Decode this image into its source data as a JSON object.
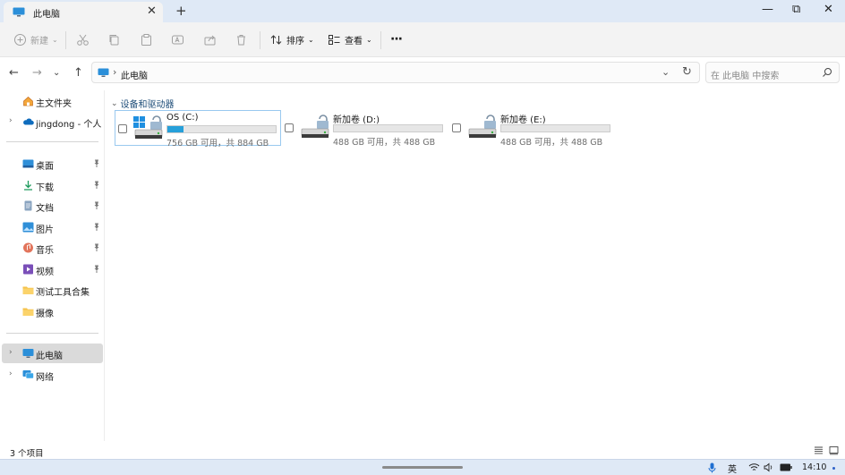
{
  "window": {
    "tab_title": "此电脑",
    "tab_close": "✕",
    "new_tab": "+",
    "minimize": "—",
    "maximize": "⧉",
    "close": "✕"
  },
  "toolbar": {
    "new_label": "新建",
    "sort_label": "排序",
    "view_label": "查看",
    "more_label": "···"
  },
  "address": {
    "location": "此电脑",
    "search_placeholder": "在 此电脑 中搜索"
  },
  "sidebar": {
    "top_items": [
      {
        "label": "主文件夹",
        "icon": "home-icon"
      },
      {
        "label": "jingdong - 个人",
        "icon": "cloud-icon"
      }
    ],
    "quick_access": [
      {
        "label": "桌面",
        "icon": "desktop-icon",
        "pinned": true
      },
      {
        "label": "下载",
        "icon": "download-icon",
        "pinned": true
      },
      {
        "label": "文档",
        "icon": "document-icon",
        "pinned": true
      },
      {
        "label": "图片",
        "icon": "pictures-icon",
        "pinned": true
      },
      {
        "label": "音乐",
        "icon": "music-icon",
        "pinned": true
      },
      {
        "label": "视频",
        "icon": "video-icon",
        "pinned": true
      },
      {
        "label": "测试工具合集",
        "icon": "folder-icon",
        "pinned": false
      },
      {
        "label": "摄像",
        "icon": "folder-icon",
        "pinned": false
      }
    ],
    "bottom_items": [
      {
        "label": "此电脑",
        "icon": "computer-icon",
        "selected": true
      },
      {
        "label": "网络",
        "icon": "network-icon",
        "selected": false
      }
    ]
  },
  "main": {
    "group_title": "设备和驱动器",
    "drives": [
      {
        "name": "OS (C:)",
        "space": "756 GB 可用，共 884 GB",
        "used_fraction": 0.145,
        "selected": true
      },
      {
        "name": "新加卷 (D:)",
        "space": "488 GB 可用，共 488 GB",
        "used_fraction": 0.0,
        "selected": false
      },
      {
        "name": "新加卷 (E:)",
        "space": "488 GB 可用，共 488 GB",
        "used_fraction": 0.0,
        "selected": false
      }
    ]
  },
  "statusbar": {
    "item_count": "3 个项目"
  },
  "taskbar": {
    "ime": "英",
    "clock": "14:10"
  },
  "colors": {
    "accent": "#26a0da",
    "titlebar": "#dfe9f6",
    "selected": "#dadada"
  }
}
